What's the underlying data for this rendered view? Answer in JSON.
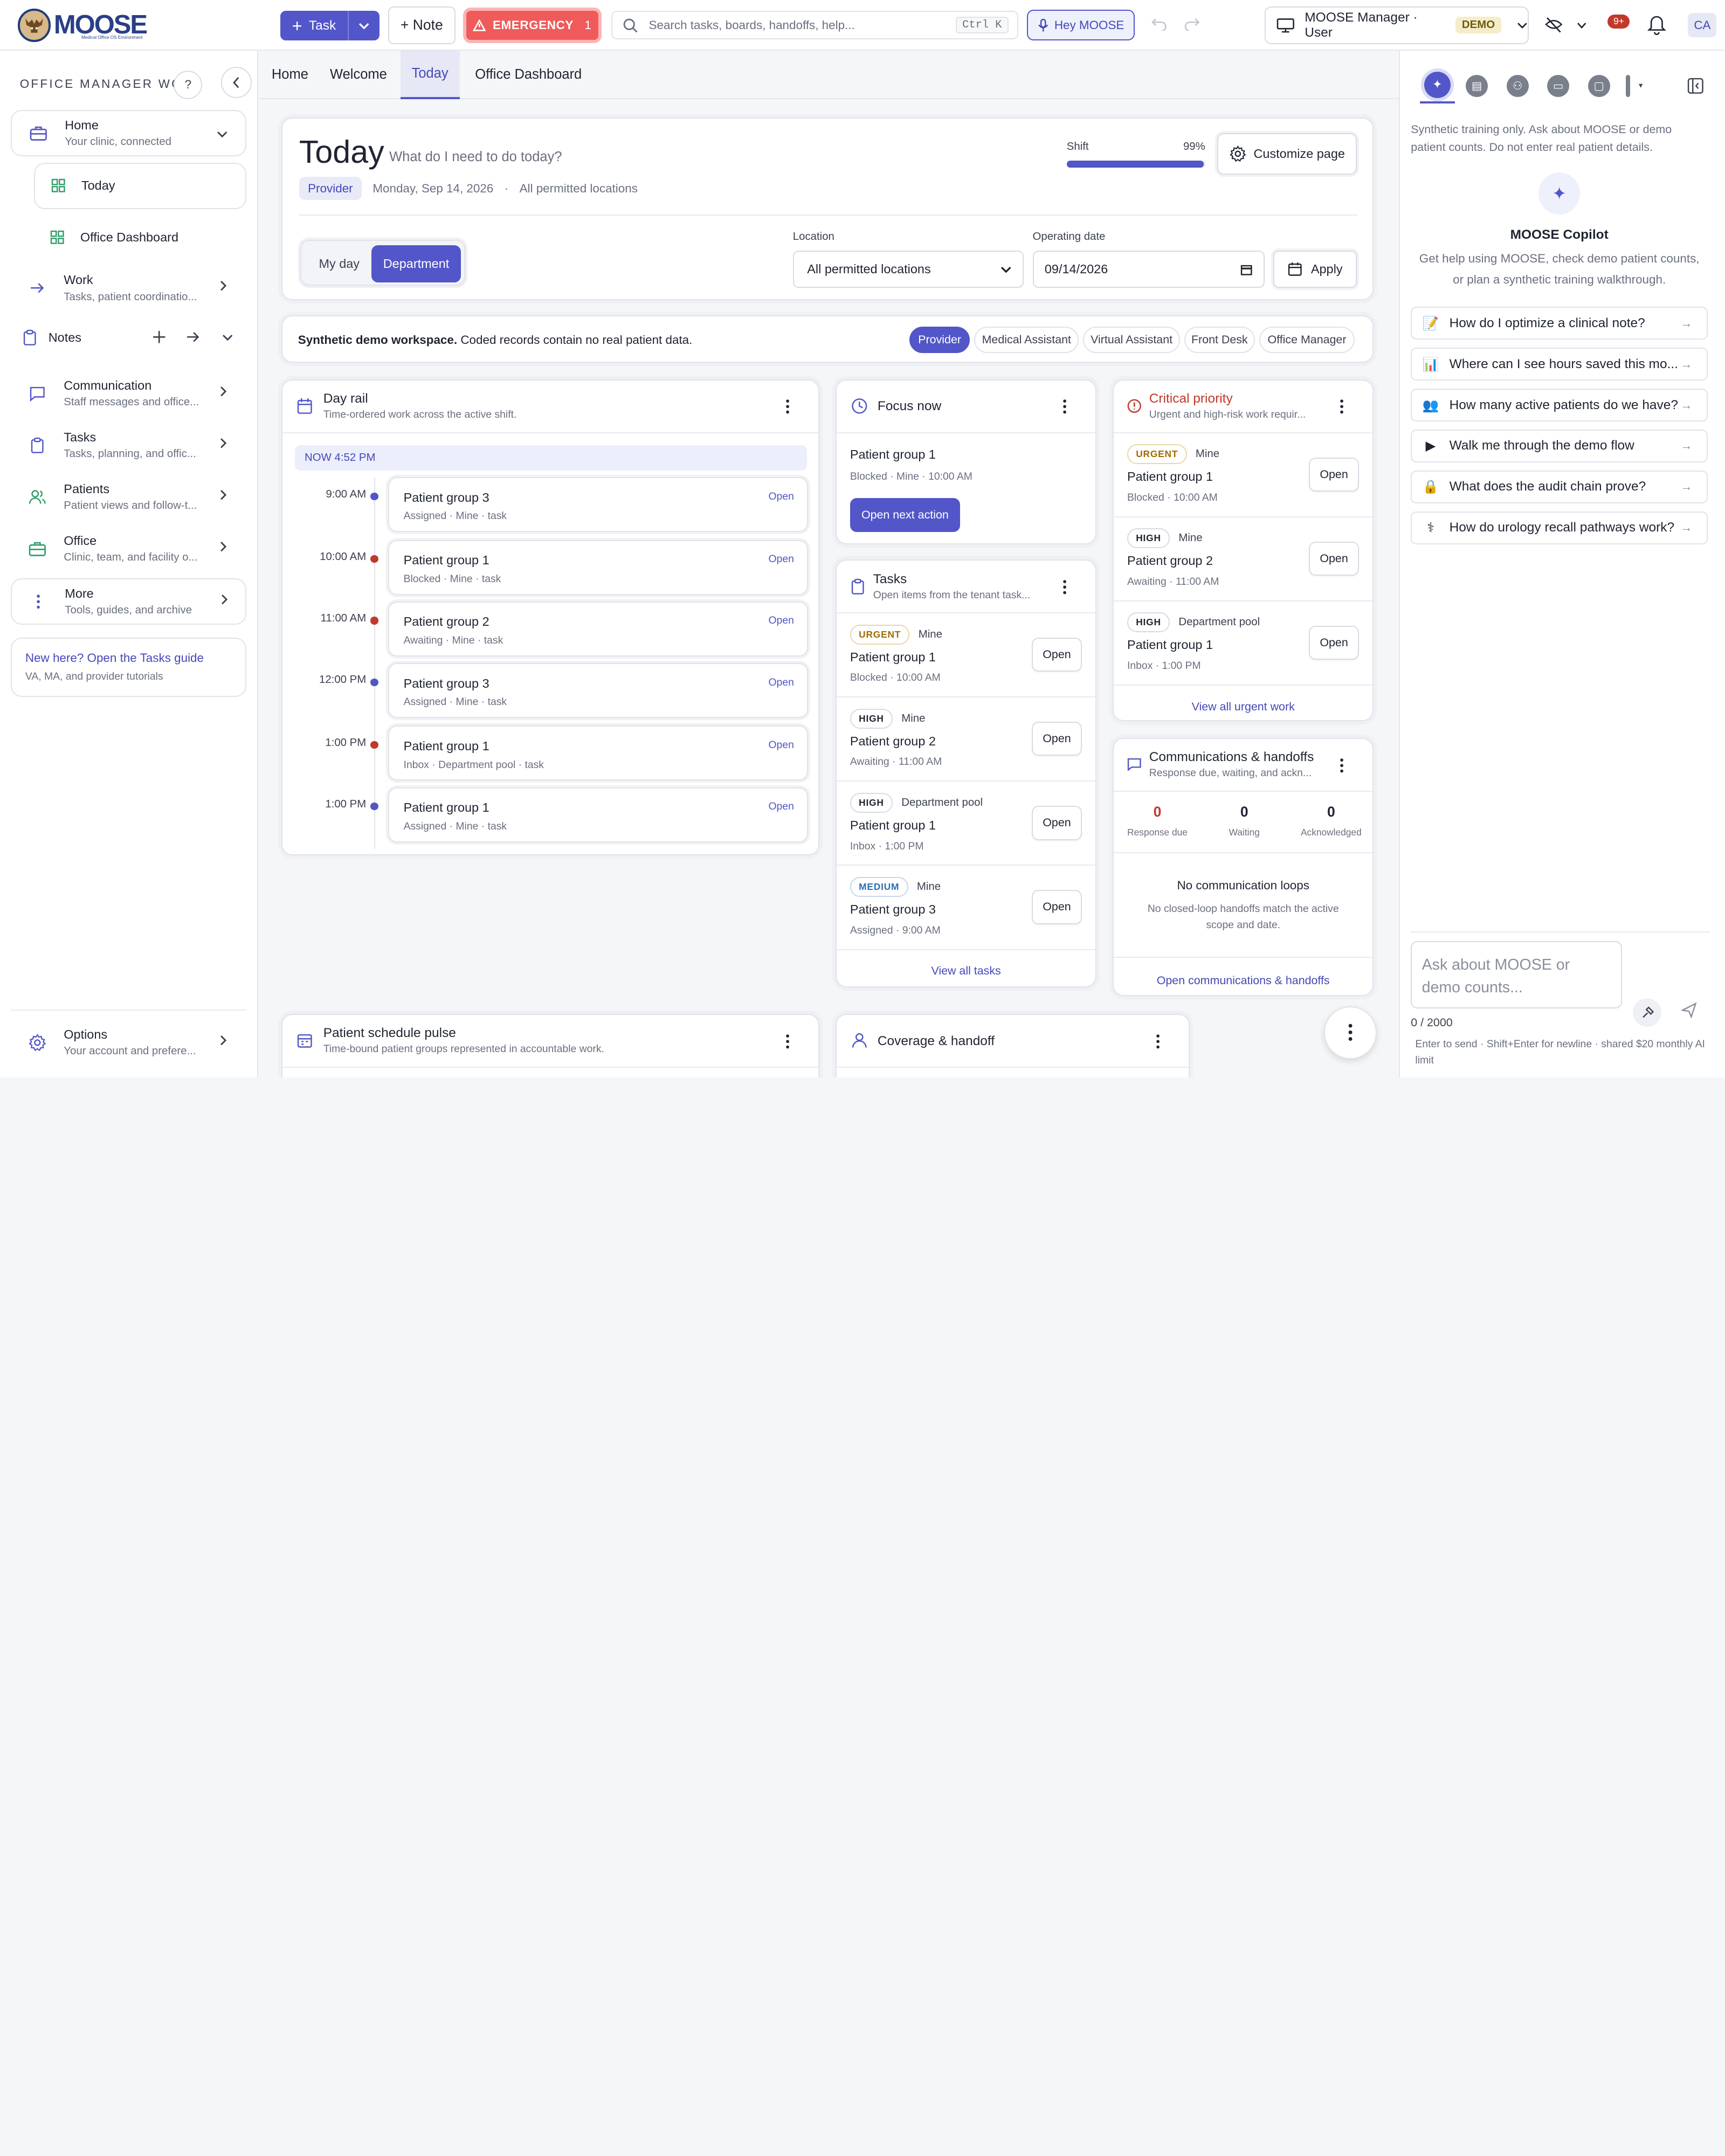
{
  "topbar": {
    "logo_text": "MOOSE",
    "logo_subtitle": "Medical Office OS Environment",
    "task_label": "Task",
    "note_label": "+ Note",
    "emergency_label": "EMERGENCY",
    "emergency_count": "1",
    "search_placeholder": "Search tasks, boards, handoffs, help...",
    "search_shortcut": "Ctrl K",
    "hey_label": "Hey MOOSE",
    "user_label": "MOOSE Manager · User",
    "demo_badge": "DEMO",
    "notif_badge": "9+",
    "avatar": "CA"
  },
  "sidebar": {
    "title": "OFFICE MANAGER WO...",
    "help": "?",
    "home": {
      "label": "Home",
      "sub": "Your clinic, connected"
    },
    "today": "Today",
    "office_dashboard": "Office Dashboard",
    "work": {
      "label": "Work",
      "sub": "Tasks, patient coordinatio..."
    },
    "notes": "Notes",
    "communication": {
      "label": "Communication",
      "sub": "Staff messages and office..."
    },
    "tasks": {
      "label": "Tasks",
      "sub": "Tasks, planning, and offic..."
    },
    "patients": {
      "label": "Patients",
      "sub": "Patient views and follow-t..."
    },
    "office": {
      "label": "Office",
      "sub": "Clinic, team, and facility o..."
    },
    "more": {
      "label": "More",
      "sub": "Tools, guides, and archive"
    },
    "guide_link": "New here? Open the Tasks guide",
    "guide_sub": "VA, MA, and provider tutorials",
    "options": {
      "label": "Options",
      "sub": "Your account and prefere..."
    }
  },
  "tabs": [
    "Home",
    "Welcome",
    "Today",
    "Office Dashboard"
  ],
  "today": {
    "title": "Today",
    "subtitle": "What do I need to do today?",
    "role": "Provider",
    "date": "Monday, Sep 14, 2026",
    "sep": "·",
    "scope": "All permitted locations",
    "shift_label": "Shift",
    "shift_pct": "99%",
    "shift_progress": 0.99,
    "customize": "Customize page",
    "seg_my_day": "My day",
    "seg_department": "Department",
    "location_label": "Location",
    "location_value": "All permitted locations",
    "opdate_label": "Operating date",
    "opdate_value": "09/14/2026",
    "apply": "Apply"
  },
  "banner": {
    "bold": "Synthetic demo workspace.",
    "text": " Coded records contain no real patient data.",
    "roles": [
      "Provider",
      "Medical Assistant",
      "Virtual Assistant",
      "Front Desk",
      "Office Manager"
    ]
  },
  "dayrail": {
    "title": "Day rail",
    "sub": "Time-ordered work across the active shift.",
    "now": "NOW  4:52 PM",
    "items": [
      {
        "time": "9:00 AM",
        "title": "Patient group 3",
        "meta": "Assigned · Mine · task",
        "open": "Open",
        "dot": "#5256c8"
      },
      {
        "time": "10:00 AM",
        "title": "Patient group 1",
        "meta": "Blocked · Mine · task",
        "open": "Open",
        "dot": "#c0392b"
      },
      {
        "time": "11:00 AM",
        "title": "Patient group 2",
        "meta": "Awaiting · Mine · task",
        "open": "Open",
        "dot": "#c0392b"
      },
      {
        "time": "12:00 PM",
        "title": "Patient group 3",
        "meta": "Assigned · Mine · task",
        "open": "Open",
        "dot": "#5256c8"
      },
      {
        "time": "1:00 PM",
        "title": "Patient group 1",
        "meta": "Inbox · Department pool · task",
        "open": "Open",
        "dot": "#c0392b"
      },
      {
        "time": "1:00 PM",
        "title": "Patient group 1",
        "meta": "Assigned · Mine · task",
        "open": "Open",
        "dot": "#5256c8"
      }
    ]
  },
  "focus": {
    "title": "Focus now",
    "item": "Patient group 1",
    "meta": "Blocked · Mine · 10:00 AM",
    "action": "Open next action"
  },
  "tasks": {
    "title": "Tasks",
    "sub": "Open items from the tenant task...",
    "items": [
      {
        "tag": "URGENT",
        "owner": "Mine",
        "title": "Patient group 1",
        "meta": "Blocked · 10:00 AM",
        "open": "Open"
      },
      {
        "tag": "HIGH",
        "owner": "Mine",
        "title": "Patient group 2",
        "meta": "Awaiting · 11:00 AM",
        "open": "Open"
      },
      {
        "tag": "HIGH",
        "owner": "Department pool",
        "title": "Patient group 1",
        "meta": "Inbox · 1:00 PM",
        "open": "Open"
      },
      {
        "tag": "MEDIUM",
        "owner": "Mine",
        "title": "Patient group 3",
        "meta": "Assigned · 9:00 AM",
        "open": "Open"
      }
    ],
    "view_all": "View all tasks"
  },
  "critical": {
    "title": "Critical priority",
    "sub": "Urgent and high-risk work requir...",
    "items": [
      {
        "tag": "URGENT",
        "owner": "Mine",
        "title": "Patient group 1",
        "meta": "Blocked · 10:00 AM",
        "open": "Open"
      },
      {
        "tag": "HIGH",
        "owner": "Mine",
        "title": "Patient group 2",
        "meta": "Awaiting · 11:00 AM",
        "open": "Open"
      },
      {
        "tag": "HIGH",
        "owner": "Department pool",
        "title": "Patient group 1",
        "meta": "Inbox · 1:00 PM",
        "open": "Open"
      }
    ],
    "view_all": "View all urgent work"
  },
  "comms": {
    "title": "Communications & handoffs",
    "sub": "Response due, waiting, and ackn...",
    "stats": [
      {
        "value": "0",
        "label": "Response due"
      },
      {
        "value": "0",
        "label": "Waiting"
      },
      {
        "value": "0",
        "label": "Acknowledged"
      }
    ],
    "empty_title": "No communication loops",
    "empty_text": "No closed-loop handoffs match the active scope and date.",
    "link": "Open communications & handoffs"
  },
  "schedule": {
    "title": "Patient schedule pulse",
    "sub": "Time-bound patient groups represented in accountable work."
  },
  "coverage": {
    "title": "Coverage & handoff"
  },
  "copilot": {
    "notice": "Synthetic training only. Ask about MOOSE or demo patient counts. Do not enter real patient details.",
    "title": "MOOSE Copilot",
    "desc": "Get help using MOOSE, check demo patient counts, or plan a synthetic training walkthrough.",
    "suggestions": [
      {
        "icon": "📝",
        "text": "How do I optimize a clinical note?"
      },
      {
        "icon": "📊",
        "text": "Where can I see hours saved this mo..."
      },
      {
        "icon": "👥",
        "text": "How many active patients do we have?"
      },
      {
        "icon": "▶",
        "text": "Walk me through the demo flow"
      },
      {
        "icon": "🔒",
        "text": "What does the audit chain prove?"
      },
      {
        "icon": "⚕",
        "text": "How do urology recall pathways work?"
      }
    ],
    "arrow": "→",
    "input_placeholder": "Ask about MOOSE or demo counts...",
    "counter": "0 / 2000",
    "hint": "Enter to send · Shift+Enter for newline · shared $20 monthly AI limit"
  },
  "colors": {
    "accent": "#5256c8",
    "emergency": "#ef5b5b",
    "critical": "#c0392b"
  }
}
